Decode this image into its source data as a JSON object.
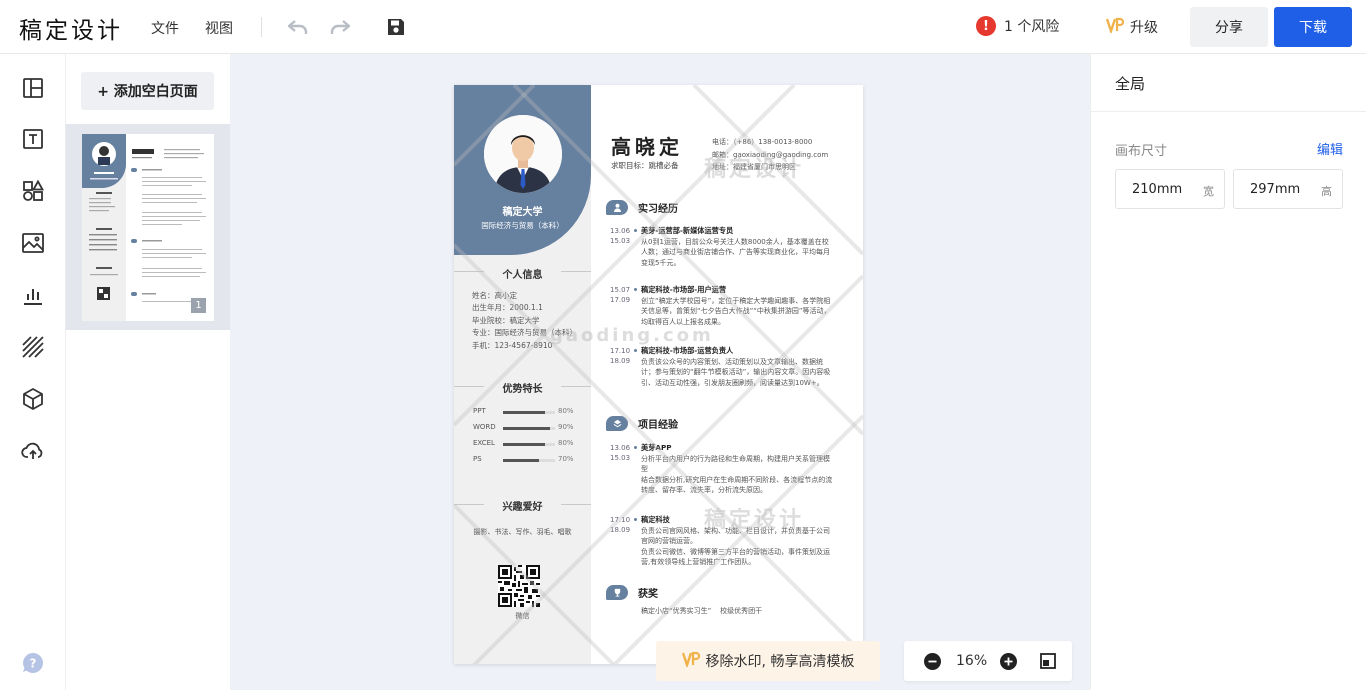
{
  "app": {
    "logo": "稿定设计"
  },
  "menu": {
    "file": "文件",
    "view": "视图"
  },
  "toolbar": {
    "risk_count": "!",
    "risk_label": "1 个风险",
    "upgrade_label": "升级",
    "share_label": "分享",
    "download_label": "下载"
  },
  "sidebar": {
    "add_page_label": "+ 添加空白页面",
    "page_number": "1"
  },
  "resume": {
    "school": "稿定大学",
    "major": "国际经济与贸易（本科）",
    "name": "高晓定",
    "goal": "求职目标：跳槽必备",
    "contact": [
      "电话：（+86）138-0013-8000",
      "邮箱：gaoxiaoding@gaoding.com",
      "地址：福建省厦门市思明区"
    ],
    "sections": {
      "personal": "个人信息",
      "skills": "优势特长",
      "hobbies": "兴趣爱好",
      "internship": "实习经历",
      "projects": "项目经验",
      "awards": "获奖"
    },
    "personal_info": [
      "姓名：高小定",
      "出生年月：2000.1.1",
      "毕业院校：稿定大学",
      "专业：国际经济与贸易（本科）",
      "手机：123-4567-8910"
    ],
    "skills": [
      {
        "name": "PPT",
        "level": 0.8,
        "label": "80%"
      },
      {
        "name": "WORD",
        "level": 0.9,
        "label": "90%"
      },
      {
        "name": "EXCEL",
        "level": 0.8,
        "label": "80%"
      },
      {
        "name": "PS",
        "level": 0.7,
        "label": "70%"
      }
    ],
    "hobbies": "摄影、书法、写作、羽毛、唱歌",
    "qr_label": "微信",
    "internship": [
      {
        "date1": "13.06",
        "date2": "15.03",
        "title": "美芽-运营部-新媒体运营专员",
        "body": "从0到1运营，目前公众号关注人数8000余人，基本覆盖在校人数；通过与商业街店铺合作、广告等实现商业化，平均每月变现5千元。"
      },
      {
        "date1": "15.07",
        "date2": "17.09",
        "title": "稿定科技-市场部-用户运营",
        "body": "创立“稿定大学校园号”，定位于稿定大学趣闻趣事、各学院相关信息等，曾策划“七夕告白大作战”“中秋集拼游园”等活动，均取得百人以上报名成果。"
      },
      {
        "date1": "17.10",
        "date2": "18.09",
        "title": "稿定科技-市场部-运营负责人",
        "body": "负责该公众号的内容策划、活动策划以及文章输出、数据统计；参与策划的“翻牛节模板活动”，输出内容文章。因内容吸引、活动互动性强，引发朋友圈刷频，阅读量达到10W+。"
      }
    ],
    "projects": [
      {
        "date1": "13.06",
        "date2": "15.03",
        "title": "美芽APP",
        "body": "分析平台内用户的行为路径和生命周期，构建用户关系管理模型\n结合数据分析,研究用户在生命周期不同阶段、各流程节点的流转度、留存率、流失率，分析流失原因。"
      },
      {
        "date1": "17.10",
        "date2": "18.09",
        "title": "稿定科技",
        "body": "负责公司官网风格、架构、功能、栏目设计，并负责基于公司官网的营销运营。\n负责公司微信、微博等第三方平台的营销活动，事件策划及运营,有效领导线上营销推广工作团队。"
      }
    ],
    "awards": "稿定小店“优秀实习生”    校级优秀团干",
    "watermark": "稿定设计",
    "watermark_domain": "gaoding.com"
  },
  "bottom": {
    "promo_label": "移除水印, 畅享高清模板",
    "zoom_label": "16%"
  },
  "right_panel": {
    "title": "全局",
    "canvas_size_label": "画布尺寸",
    "edit_label": "编辑",
    "width_value": "210mm",
    "width_unit": "宽",
    "height_value": "297mm",
    "height_unit": "高"
  },
  "colors": {
    "accent": "#1f5fe8",
    "resume_blue": "#6680a0",
    "risk_red": "#e5392f"
  }
}
